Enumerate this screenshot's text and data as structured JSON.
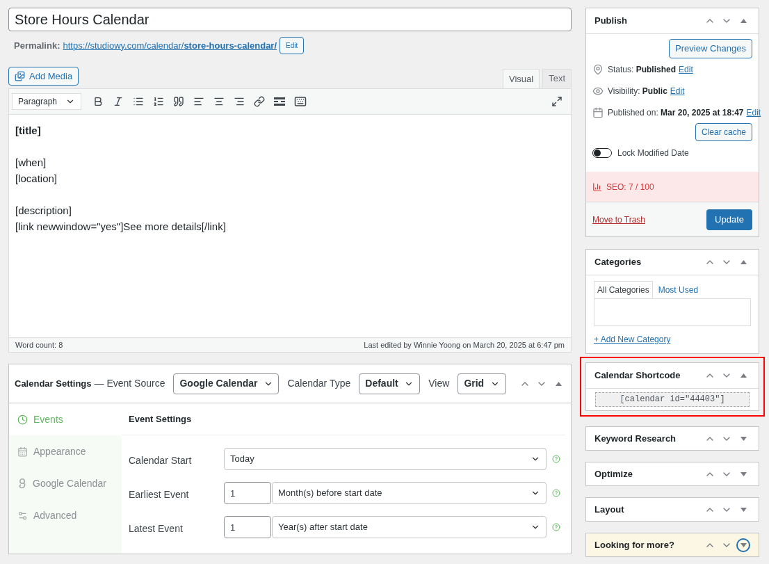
{
  "title_field": {
    "value": "Store Hours Calendar"
  },
  "permalink": {
    "label": "Permalink:",
    "url_base": "https://studiowy.com/calendar/",
    "url_slug": "store-hours-calendar/",
    "edit_button": "Edit"
  },
  "add_media": "Add Media",
  "editor_tabs": [
    {
      "label": "Visual",
      "selected": true
    },
    {
      "label": "Text",
      "selected": false
    }
  ],
  "format_select": "Paragraph",
  "content": [
    [
      "[title]"
    ],
    [
      "[when]",
      "[location]"
    ],
    [
      "[description]",
      "[link newwindow=\"yes\"]See more details[/link]"
    ]
  ],
  "word_count": "Word count: 8",
  "last_edited": "Last edited by Winnie Yoong on March 20, 2025 at 6:47 pm",
  "calendar_settings": {
    "title": "Calendar Settings",
    "event_source_label": "— Event Source",
    "event_source": "Google Calendar",
    "calendar_type_label": "Calendar Type",
    "calendar_type": "Default",
    "view_label": "View",
    "view": "Grid",
    "expanded": true,
    "tabs": [
      {
        "label": "Events",
        "selected": true
      },
      {
        "label": "Appearance",
        "selected": false
      },
      {
        "label": "Google Calendar",
        "selected": false
      },
      {
        "label": "Advanced",
        "selected": false
      }
    ],
    "section_title": "Event Settings",
    "fields": [
      {
        "label": "Calendar Start",
        "kind": "select",
        "value": "Today"
      },
      {
        "label": "Earliest Event",
        "kind": "number_select",
        "number": "1",
        "value": "Month(s) before start date"
      },
      {
        "label": "Latest Event",
        "kind": "number_select",
        "number": "1",
        "value": "Year(s) after start date"
      }
    ]
  },
  "publish": {
    "title": "Publish",
    "expanded": true,
    "preview_button": "Preview Changes",
    "rows": [
      {
        "label": "Status:",
        "value": "Published",
        "link": "Edit"
      },
      {
        "label": "Visibility:",
        "value": "Public",
        "link": "Edit"
      },
      {
        "label": "Published on:",
        "value": "Mar 20, 2025 at 18:47",
        "link": "Edit"
      }
    ],
    "clear_cache": "Clear cache",
    "lock_toggle": {
      "label": "Lock Modified Date",
      "on": false
    },
    "seo": "SEO: 7 / 100",
    "trash": "Move to Trash",
    "update": "Update"
  },
  "categories": {
    "title": "Categories",
    "expanded": true,
    "tabs": [
      {
        "label": "All Categories",
        "selected": true
      },
      {
        "label": "Most Used",
        "selected": false
      }
    ],
    "add_link": "+ Add New Category"
  },
  "shortcode": {
    "title": "Calendar Shortcode",
    "expanded": true,
    "highlighted": true,
    "code": "[calendar id=\"44403\"]"
  },
  "collapsed_boxes": [
    {
      "title": "Keyword Research",
      "expanded": false,
      "kind": "plain"
    },
    {
      "title": "Optimize",
      "expanded": false,
      "kind": "plain"
    },
    {
      "title": "Layout",
      "expanded": false,
      "kind": "plain"
    },
    {
      "title": "Looking for more?",
      "expanded": false,
      "kind": "promo"
    }
  ]
}
